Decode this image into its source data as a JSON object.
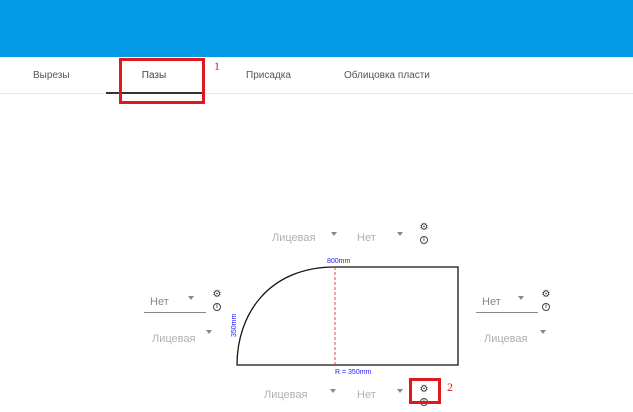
{
  "tabs": [
    {
      "label": "Вырезы"
    },
    {
      "label": "Пазы"
    },
    {
      "label": "Присадка"
    },
    {
      "label": "Облицовка пласти"
    }
  ],
  "annotations": {
    "first": "1",
    "second": "2"
  },
  "drawing": {
    "width_label": "800mm",
    "height_label": "350mm",
    "radius_label": "R = 350mm"
  },
  "edges": {
    "top": {
      "side": "Лицевая",
      "option": "Нет"
    },
    "left": {
      "option": "Нет",
      "side": "Лицевая"
    },
    "right": {
      "option": "Нет",
      "side": "Лицевая"
    },
    "bottom": {
      "side": "Лицевая",
      "option": "Нет"
    }
  },
  "icons": {
    "gear": "gear-icon",
    "info": "info-icon"
  },
  "colors": {
    "header": "#039be5",
    "annotation": "#e0191c",
    "dimension": "#1a1aff",
    "guide": "#e0191c"
  }
}
